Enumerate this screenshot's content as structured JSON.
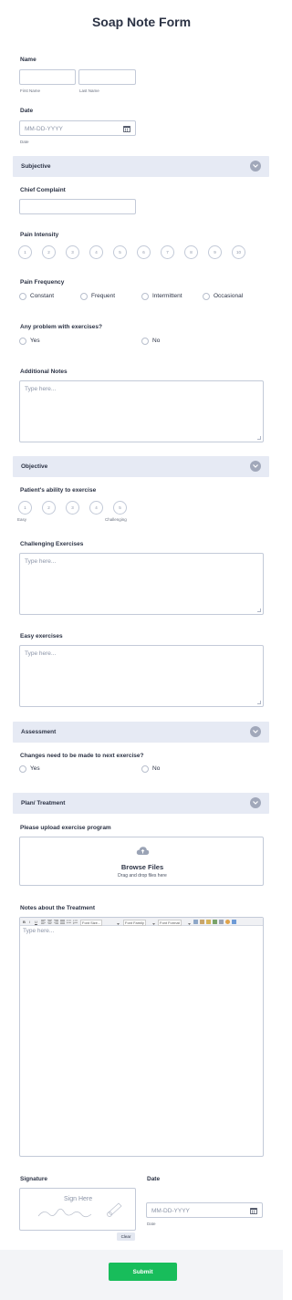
{
  "form": {
    "title": "Soap Note Form"
  },
  "name": {
    "label": "Name",
    "first_sub": "First Name",
    "last_sub": "Last Name"
  },
  "date1": {
    "label": "Date",
    "placeholder": "MM-DD-YYYY",
    "sub": "Date"
  },
  "subjective": {
    "title": "Subjective",
    "chief_label": "Chief Complaint",
    "pain_intensity_label": "Pain Intensity",
    "pain_intensity": [
      "1",
      "2",
      "3",
      "4",
      "5",
      "6",
      "7",
      "8",
      "9",
      "10"
    ],
    "pain_frequency_label": "Pain Frequency",
    "pain_frequency": [
      "Constant",
      "Frequent",
      "Intermittent",
      "Occasional"
    ],
    "problem_label": "Any problem with exercises?",
    "problem_yes": "Yes",
    "problem_no": "No",
    "notes_label": "Additional Notes",
    "notes_placeholder": "Type here..."
  },
  "objective": {
    "title": "Objective",
    "ability_label": "Patient's ability to exercise",
    "ability": [
      "1",
      "2",
      "3",
      "4",
      "5"
    ],
    "ability_low": "Easy",
    "ability_high": "Challenging",
    "challenging_label": "Challenging Exercises",
    "challenging_placeholder": "Type here...",
    "easy_label": "Easy exercises",
    "easy_placeholder": "Type here..."
  },
  "assessment": {
    "title": "Assessment",
    "changes_label": "Changes need to be made to next exercise?",
    "yes": "Yes",
    "no": "No"
  },
  "plan": {
    "title": "Plan/ Treatment",
    "upload_label": "Please upload exercise program",
    "browse": "Browse Files",
    "drag": "Drag and drop files here",
    "notes_label": "Notes about the Treatment",
    "toolbar": {
      "bold": "B",
      "italic": "I",
      "underline": "U",
      "font_size": "Font Size...",
      "font_family": "Font Family",
      "font_format": "Font Format"
    },
    "notes_placeholder": "Type here..."
  },
  "signature": {
    "label": "Signature",
    "placeholder": "Sign Here",
    "clear": "Clear"
  },
  "date2": {
    "label": "Date",
    "placeholder": "MM-DD-YYYY",
    "sub": "Date"
  },
  "submit": "Submit",
  "colors": {
    "accent": "#18bd5b",
    "section_bg": "#e6eaf4",
    "text": "#2c3345"
  }
}
